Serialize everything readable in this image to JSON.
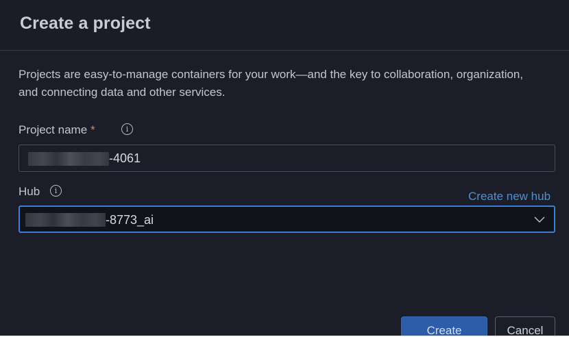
{
  "dialog": {
    "title": "Create a project",
    "description": "Projects are easy-to-manage containers for your work—and the key to collaboration, organization, and connecting data and other services."
  },
  "project_name": {
    "label": "Project name",
    "required_marker": "*",
    "value_suffix": "-4061",
    "info_icon": "info-icon"
  },
  "hub": {
    "label": "Hub",
    "info_icon": "info-icon",
    "create_new_link": "Create new hub",
    "selected_value_suffix": "-8773_ai",
    "dropdown_icon": "chevron-down-icon"
  },
  "footer": {
    "create_label": "Create",
    "cancel_label": "Cancel"
  },
  "colors": {
    "background": "#1b1e28",
    "primary_button": "#2e5da8",
    "link": "#4f8fd6",
    "focus_border": "#3d7fd6",
    "required": "#e07a7a"
  }
}
